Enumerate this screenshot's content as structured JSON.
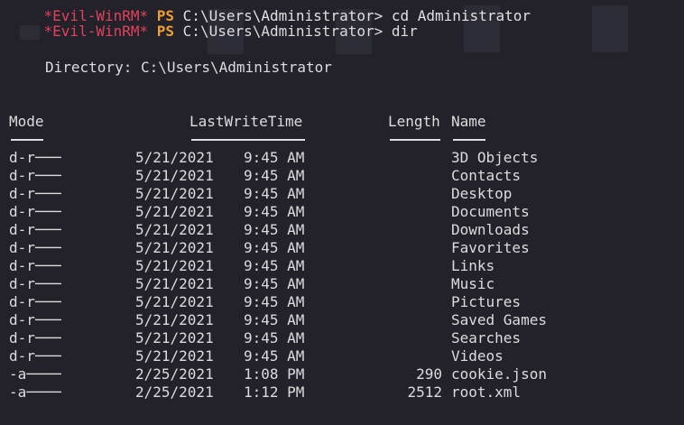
{
  "prompt_top_cut": {
    "tag": "*Evil-WinRM*",
    "ps": "PS",
    "cmd": "C:\\Users\\Administrator> cd Administrator"
  },
  "prompt": {
    "tag": "*Evil-WinRM*",
    "ps": "PS",
    "path": "C:\\Users\\Administrator>",
    "command": "dir"
  },
  "directory_label": "Directory: C:\\Users\\Administrator",
  "headers": {
    "mode": "Mode",
    "lastwrite": "LastWriteTime",
    "length": "Length",
    "name": "Name"
  },
  "rows": [
    {
      "mode": "d-r───",
      "date": "5/21/2021",
      "time": "9:45 AM",
      "length": "",
      "name": "3D Objects"
    },
    {
      "mode": "d-r───",
      "date": "5/21/2021",
      "time": "9:45 AM",
      "length": "",
      "name": "Contacts"
    },
    {
      "mode": "d-r───",
      "date": "5/21/2021",
      "time": "9:45 AM",
      "length": "",
      "name": "Desktop"
    },
    {
      "mode": "d-r───",
      "date": "5/21/2021",
      "time": "9:45 AM",
      "length": "",
      "name": "Documents"
    },
    {
      "mode": "d-r───",
      "date": "5/21/2021",
      "time": "9:45 AM",
      "length": "",
      "name": "Downloads"
    },
    {
      "mode": "d-r───",
      "date": "5/21/2021",
      "time": "9:45 AM",
      "length": "",
      "name": "Favorites"
    },
    {
      "mode": "d-r───",
      "date": "5/21/2021",
      "time": "9:45 AM",
      "length": "",
      "name": "Links"
    },
    {
      "mode": "d-r───",
      "date": "5/21/2021",
      "time": "9:45 AM",
      "length": "",
      "name": "Music"
    },
    {
      "mode": "d-r───",
      "date": "5/21/2021",
      "time": "9:45 AM",
      "length": "",
      "name": "Pictures"
    },
    {
      "mode": "d-r───",
      "date": "5/21/2021",
      "time": "9:45 AM",
      "length": "",
      "name": "Saved Games"
    },
    {
      "mode": "d-r───",
      "date": "5/21/2021",
      "time": "9:45 AM",
      "length": "",
      "name": "Searches"
    },
    {
      "mode": "d-r───",
      "date": "5/21/2021",
      "time": "9:45 AM",
      "length": "",
      "name": "Videos"
    },
    {
      "mode": "-a────",
      "date": "2/25/2021",
      "time": "1:08 PM",
      "length": "290",
      "name": "cookie.json"
    },
    {
      "mode": "-a────",
      "date": "2/25/2021",
      "time": "1:12 PM",
      "length": "2512",
      "name": "root.xml"
    }
  ],
  "colors": {
    "background": "#23222b",
    "text": "#dcdcdc",
    "prompt_tag": "#e0425a",
    "ps": "#f0a030"
  }
}
